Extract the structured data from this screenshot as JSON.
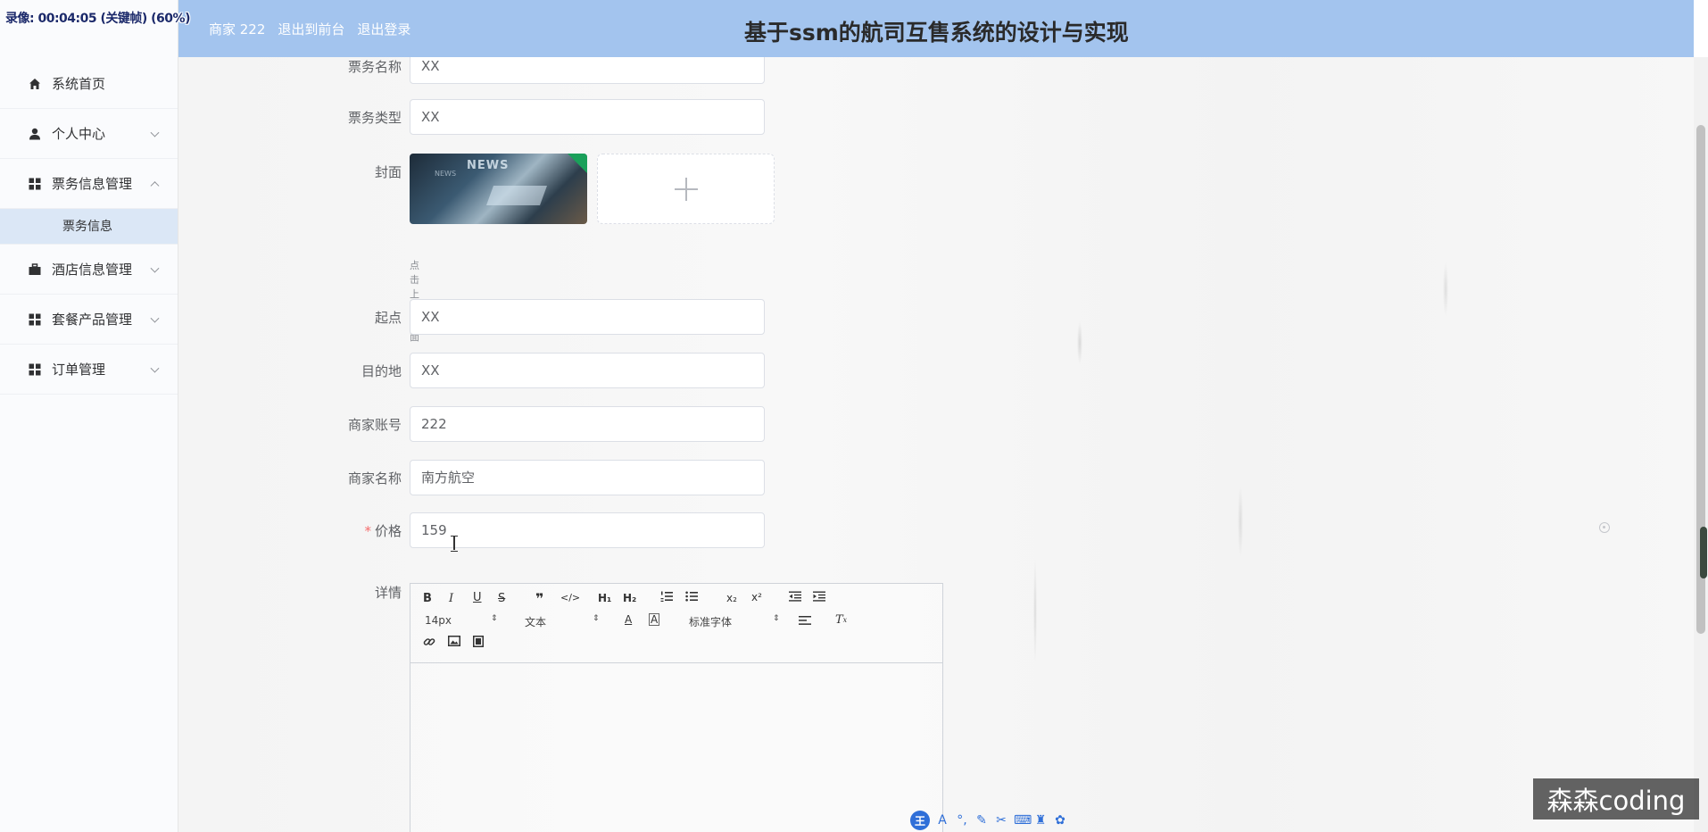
{
  "recording": {
    "status": "录像: 00:04:05 (关键帧) (60%)"
  },
  "header": {
    "user": "商家 222",
    "back_front": "退出到前台",
    "logout": "退出登录",
    "title": "基于ssm的航司互售系统的设计与实现"
  },
  "sidebar": {
    "items": [
      {
        "label": "系统首页",
        "icon": "home-icon"
      },
      {
        "label": "个人中心",
        "icon": "user-icon"
      },
      {
        "label": "票务信息管理",
        "icon": "grid-icon"
      },
      {
        "label": "酒店信息管理",
        "icon": "briefcase-icon"
      },
      {
        "label": "套餐产品管理",
        "icon": "grid-icon"
      },
      {
        "label": "订单管理",
        "icon": "grid-icon"
      }
    ],
    "sub_item": "票务信息"
  },
  "form": {
    "ticket_name_label": "票务名称",
    "ticket_name": "XX",
    "ticket_type_label": "票务类型",
    "ticket_type": "XX",
    "cover_label": "封面",
    "upload_tip": "点击上传封面",
    "origin_label": "起点",
    "origin": "XX",
    "destination_label": "目的地",
    "destination": "XX",
    "merchant_account_label": "商家账号",
    "merchant_account": "222",
    "merchant_name_label": "商家名称",
    "merchant_name": "南方航空",
    "price_required": "*",
    "price_label": "价格",
    "price": "159",
    "details_label": "详情"
  },
  "editor": {
    "font_size": "14px",
    "paragraph": "文本",
    "font_family": "标准字体"
  },
  "cover_image": {
    "thumb_text": "NEWS"
  },
  "watermark": "森森coding",
  "ime": {
    "badge": "王"
  },
  "colors": {
    "header_bg": "#a3c4ee",
    "active_sub_bg": "#dbe7f6",
    "required": "#f56c6c"
  }
}
